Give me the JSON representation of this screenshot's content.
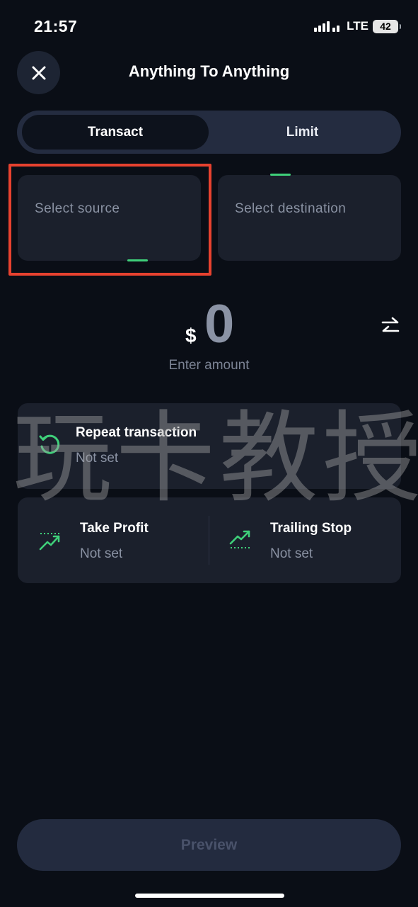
{
  "status_bar": {
    "time": "21:57",
    "network": "LTE",
    "battery": "42"
  },
  "header": {
    "title": "Anything To Anything",
    "close_icon": "close-icon"
  },
  "tabs": [
    {
      "label": "Transact",
      "active": true
    },
    {
      "label": "Limit",
      "active": false
    }
  ],
  "source_card": {
    "label": "Select source"
  },
  "destination_card": {
    "label": "Select destination"
  },
  "amount": {
    "currency_symbol": "$",
    "value": "0",
    "hint": "Enter amount",
    "swap_icon": "swap-arrows-icon"
  },
  "repeat": {
    "title": "Repeat transaction",
    "value": "Not set",
    "icon": "repeat-icon"
  },
  "take_profit": {
    "title": "Take Profit",
    "value": "Not set",
    "icon": "take-profit-icon"
  },
  "trailing_stop": {
    "title": "Trailing Stop",
    "value": "Not set",
    "icon": "trailing-stop-icon"
  },
  "watermark": "玩卡教授",
  "preview_button": {
    "label": "Preview"
  },
  "colors": {
    "background": "#0a0e16",
    "card": "#1b202c",
    "accent_green": "#3fd07a",
    "highlight_red": "#e8422f",
    "muted_text": "#8a92a3"
  }
}
